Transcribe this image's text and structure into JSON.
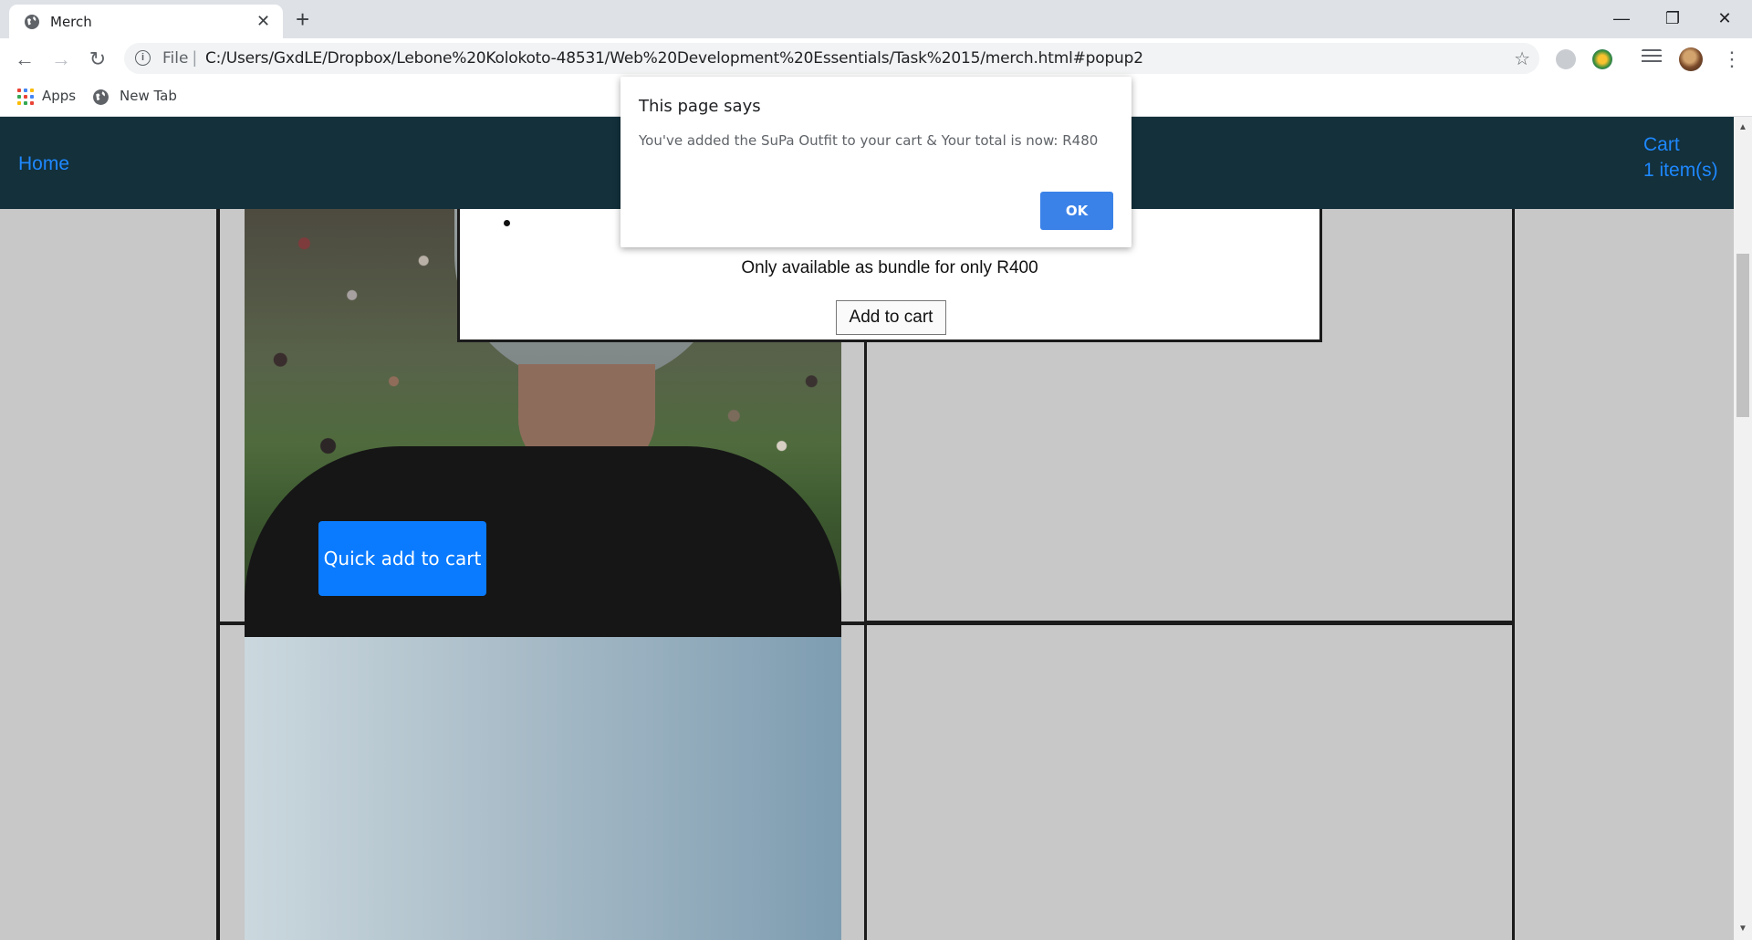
{
  "browser": {
    "tab_title": "Merch",
    "new_tab_symbol": "+",
    "close_symbol": "✕",
    "window_controls": {
      "minimize": "—",
      "restore": "❐",
      "close": "✕"
    },
    "nav": {
      "back": "←",
      "forward": "→",
      "reload": "↻"
    },
    "address": {
      "info_symbol": "i",
      "scheme_label": "File",
      "separator": "|",
      "url": "C:/Users/GxdLE/Dropbox/Lebone%20Kolokoto-48531/Web%20Development%20Essentials/Task%2015/merch.html#popup2",
      "star_symbol": "☆"
    },
    "menu_symbol": "⋮",
    "bookmarks": [
      {
        "label": "Apps",
        "icon": "apps-grid-icon"
      },
      {
        "label": "New Tab",
        "icon": "globe-icon"
      }
    ],
    "apps_grid_colors": [
      "#ea4335",
      "#4285f4",
      "#fbbc05",
      "#34a853",
      "#ea4335",
      "#4285f4",
      "#fbbc05",
      "#34a853",
      "#ea4335"
    ]
  },
  "navbar": {
    "home_label": "Home",
    "cart_label": "Cart",
    "cart_count": "1 item(s)"
  },
  "product": {
    "quick_add_label": "Quick add to cart"
  },
  "popup": {
    "bundle_text": "Only available as bundle for only R400",
    "add_button_label": "Add to cart"
  },
  "alert": {
    "heading": "This page says",
    "message": "You've added the SuPa Outfit to your cart & Your total is now: R480",
    "ok_label": "OK"
  },
  "scrollbar": {
    "up_arrow": "▲",
    "down_arrow": "▼"
  },
  "colors": {
    "navbar_bg": "#13303b",
    "link": "#1e88ff",
    "primary_button": "#0a7bff",
    "alert_ok": "#3b82e8",
    "page_bg": "#c8c8c8"
  }
}
